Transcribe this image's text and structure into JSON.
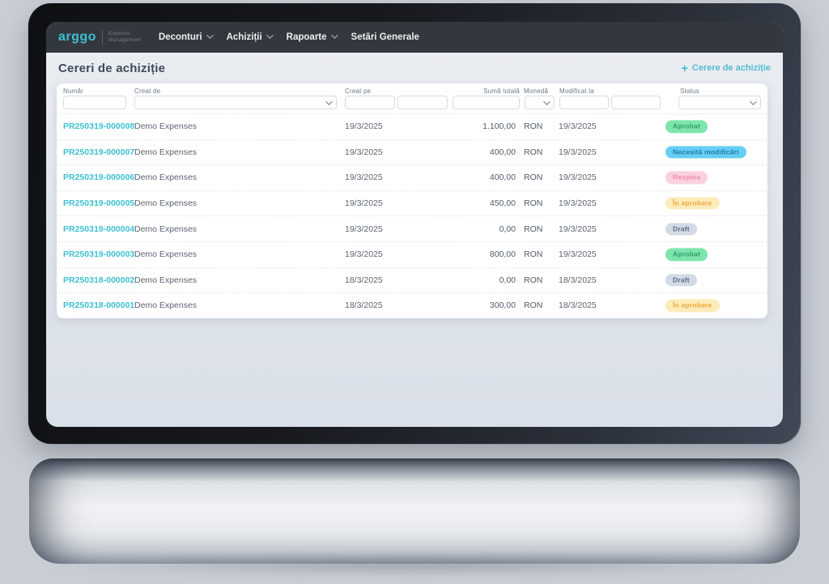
{
  "brand": {
    "name": "arggo",
    "tagline_line1": "Expense",
    "tagline_line2": "Management"
  },
  "nav": {
    "items": [
      {
        "label": "Deconturi",
        "has_dropdown": true
      },
      {
        "label": "Achiziții",
        "has_dropdown": true
      },
      {
        "label": "Rapoarte",
        "has_dropdown": true
      },
      {
        "label": "Setări Generale",
        "has_dropdown": false
      }
    ]
  },
  "page": {
    "title": "Cereri de achiziție",
    "plus_icon": "+",
    "add_button_label": "Cerere de achiziție"
  },
  "table": {
    "columns": [
      {
        "label": "Număr",
        "filter": "text"
      },
      {
        "label": "Creat de",
        "filter": "select"
      },
      {
        "label": "Creat pe",
        "filter": "date-range"
      },
      {
        "label": "Sumă totală",
        "filter": "text"
      },
      {
        "label": "Monedă",
        "filter": "select"
      },
      {
        "label": "Modificat la",
        "filter": "date-range"
      },
      {
        "label": "Status",
        "filter": "select"
      }
    ],
    "rows": [
      {
        "number": "PR250319-000008",
        "created_by": "Demo Expenses",
        "created_on": "19/3/2025",
        "total": "1.100,00",
        "currency": "RON",
        "modified_on": "19/3/2025",
        "status": "Aprobat",
        "status_key": "approved"
      },
      {
        "number": "PR250319-000007",
        "created_by": "Demo Expenses",
        "created_on": "19/3/2025",
        "total": "400,00",
        "currency": "RON",
        "modified_on": "19/3/2025",
        "status": "Necesită modificări",
        "status_key": "needs-changes"
      },
      {
        "number": "PR250319-000006",
        "created_by": "Demo Expenses",
        "created_on": "19/3/2025",
        "total": "400,00",
        "currency": "RON",
        "modified_on": "19/3/2025",
        "status": "Respins",
        "status_key": "rejected"
      },
      {
        "number": "PR250319-000005",
        "created_by": "Demo Expenses",
        "created_on": "19/3/2025",
        "total": "450,00",
        "currency": "RON",
        "modified_on": "19/3/2025",
        "status": "În aprobare",
        "status_key": "pending"
      },
      {
        "number": "PR250319-000004",
        "created_by": "Demo Expenses",
        "created_on": "19/3/2025",
        "total": "0,00",
        "currency": "RON",
        "modified_on": "19/3/2025",
        "status": "Draft",
        "status_key": "draft"
      },
      {
        "number": "PR250319-000003",
        "created_by": "Demo Expenses",
        "created_on": "19/3/2025",
        "total": "800,00",
        "currency": "RON",
        "modified_on": "19/3/2025",
        "status": "Aprobat",
        "status_key": "approved"
      },
      {
        "number": "PR250318-000002",
        "created_by": "Demo Expenses",
        "created_on": "18/3/2025",
        "total": "0,00",
        "currency": "RON",
        "modified_on": "18/3/2025",
        "status": "Draft",
        "status_key": "draft"
      },
      {
        "number": "PR250318-000001",
        "created_by": "Demo Expenses",
        "created_on": "18/3/2025",
        "total": "300,00",
        "currency": "RON",
        "modified_on": "18/3/2025",
        "status": "În aprobare",
        "status_key": "pending"
      }
    ]
  },
  "status_colors": {
    "approved": {
      "bg": "#7de5ac",
      "text": "#2fa06c"
    },
    "needs-changes": {
      "bg": "#67cef3",
      "text": "#1f7aa6"
    },
    "rejected": {
      "bg": "#fbd1e0",
      "text": "#ef8ab2"
    },
    "pending": {
      "bg": "#fdecb9",
      "text": "#eda83c"
    },
    "draft": {
      "bg": "#d3dae6",
      "text": "#5b6a83"
    }
  },
  "colors": {
    "accent": "#3ec0d2",
    "navbar_bg": "#33383e",
    "link": "#3ec0d2",
    "page_bg": "#dde2ea",
    "card_bg": "#ffffff"
  }
}
